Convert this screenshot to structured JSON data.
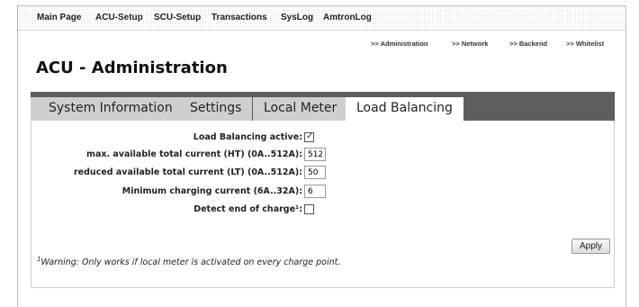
{
  "top_nav": [
    "Main Page",
    "ACU-Setup",
    "SCU-Setup",
    "Transactions",
    "SysLog",
    "AmtronLog"
  ],
  "sub_nav": [
    ">> Administration",
    ">> Network",
    ">> Backend",
    ">> Whitelist"
  ],
  "page_title": "ACU - Administration",
  "tabs": [
    {
      "label": "System Information",
      "active": false
    },
    {
      "label": "Settings",
      "active": false
    },
    {
      "label": "Local Meter",
      "active": false
    },
    {
      "label": "Load Balancing",
      "active": true
    }
  ],
  "form": {
    "load_balancing_active": {
      "label": "Load Balancing active:",
      "checked": true
    },
    "max_total_current": {
      "label": "max. available total current (HT) (0A..512A):",
      "value": "512"
    },
    "reduced_total_current": {
      "label": "reduced available total current (LT) (0A..512A):",
      "value": "50"
    },
    "min_charging_current": {
      "label": "Minimum charging current (6A..32A):",
      "value": "6"
    },
    "detect_end_of_charge": {
      "label": "Detect end of charge¹:",
      "checked": false
    }
  },
  "apply_label": "Apply",
  "footnote": {
    "marker": "1",
    "text": "Warning: Only works if local meter is activated on every charge point."
  },
  "colors": {
    "tab_bar": "#5e5e5e",
    "tab_inactive": "#cfcfcf",
    "tab_active": "#ffffff"
  }
}
